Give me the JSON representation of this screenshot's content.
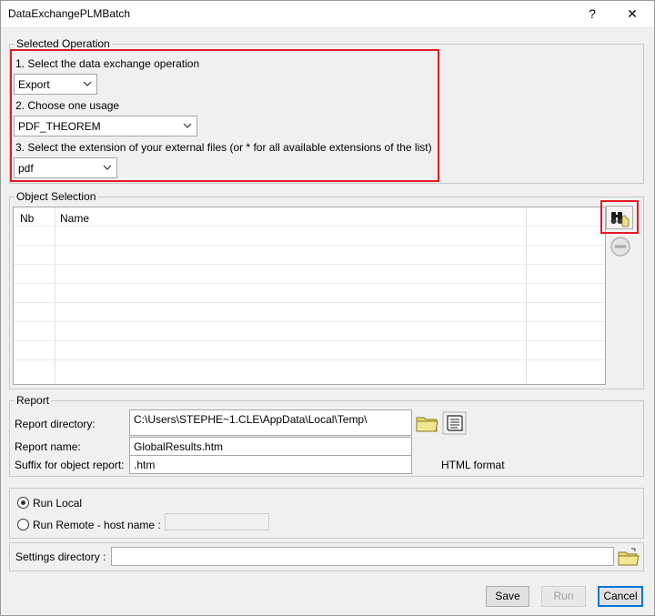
{
  "window": {
    "title": "DataExchangePLMBatch",
    "help_label": "?",
    "close_label": "✕"
  },
  "selected_operation": {
    "legend": "Selected Operation",
    "step1_label": "1. Select the data exchange operation",
    "operation_value": "Export",
    "step2_label": "2. Choose one usage",
    "usage_value": "PDF_THEOREM",
    "step3_label": "3. Select the extension of your external files (or * for all available extensions of the list)",
    "extension_value": "pdf"
  },
  "object_selection": {
    "legend": "Object Selection",
    "columns": [
      "Nb",
      "Name"
    ]
  },
  "report": {
    "legend": "Report",
    "directory_label": "Report directory:",
    "directory_value": "C:\\Users\\STEPHE~1.CLE\\AppData\\Local\\Temp\\",
    "name_label": "Report name:",
    "name_value": "GlobalResults.htm",
    "suffix_label": "Suffix for object report:",
    "suffix_value": ".htm",
    "format_label": "HTML format"
  },
  "run": {
    "local_label": "Run Local",
    "remote_label": "Run Remote - host name :",
    "host_value": ""
  },
  "settings": {
    "directory_label": "Settings directory :",
    "directory_value": ""
  },
  "buttons": {
    "save": "Save",
    "run": "Run",
    "cancel": "Cancel"
  }
}
